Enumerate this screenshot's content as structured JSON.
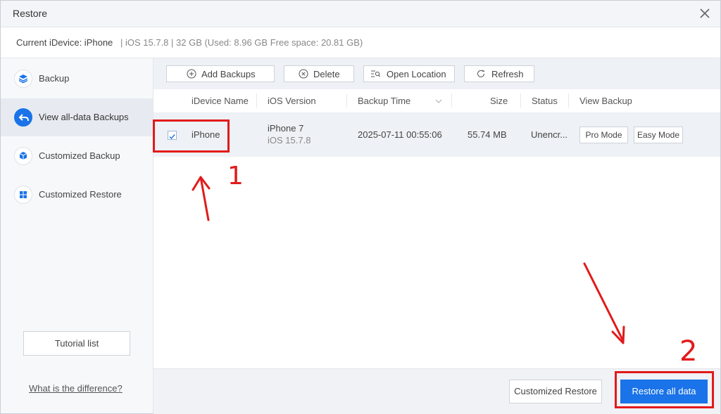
{
  "window": {
    "title": "Restore"
  },
  "device_bar": {
    "current_device": "Current iDevice: iPhone",
    "details": "|  iOS 15.7.8  |  32 GB (Used: 8.96 GB Free space: 20.81 GB)"
  },
  "sidebar": {
    "items": [
      {
        "label": "Backup",
        "icon": "layers-icon"
      },
      {
        "label": "View all-data Backups",
        "icon": "back-arrow-icon",
        "active": true
      },
      {
        "label": "Customized Backup",
        "icon": "cube-icon"
      },
      {
        "label": "Customized Restore",
        "icon": "grid-icon"
      }
    ],
    "tutorial_label": "Tutorial list",
    "difference_link": "What is the difference?"
  },
  "toolbar": {
    "add_label": "Add Backups",
    "delete_label": "Delete",
    "open_label": "Open Location",
    "refresh_label": "Refresh"
  },
  "table": {
    "headers": [
      "iDevice Name",
      "iOS Version",
      "Backup Time",
      "Size",
      "Status",
      "View Backup"
    ],
    "rows": [
      {
        "checked": true,
        "device_name": "iPhone",
        "model": "iPhone 7",
        "ios": "iOS 15.7.8",
        "backup_time": "2025-07-11 00:55:06",
        "size": "55.74 MB",
        "status": "Unencr...",
        "pro_mode": "Pro Mode",
        "easy_mode": "Easy Mode"
      }
    ]
  },
  "footer": {
    "customized_restore_label": "Customized Restore",
    "restore_all_label": "Restore all data"
  },
  "annotations": {
    "step1": "1",
    "step2": "2"
  },
  "colors": {
    "accent": "#1a73e8",
    "annotation": "#e21a1a"
  }
}
